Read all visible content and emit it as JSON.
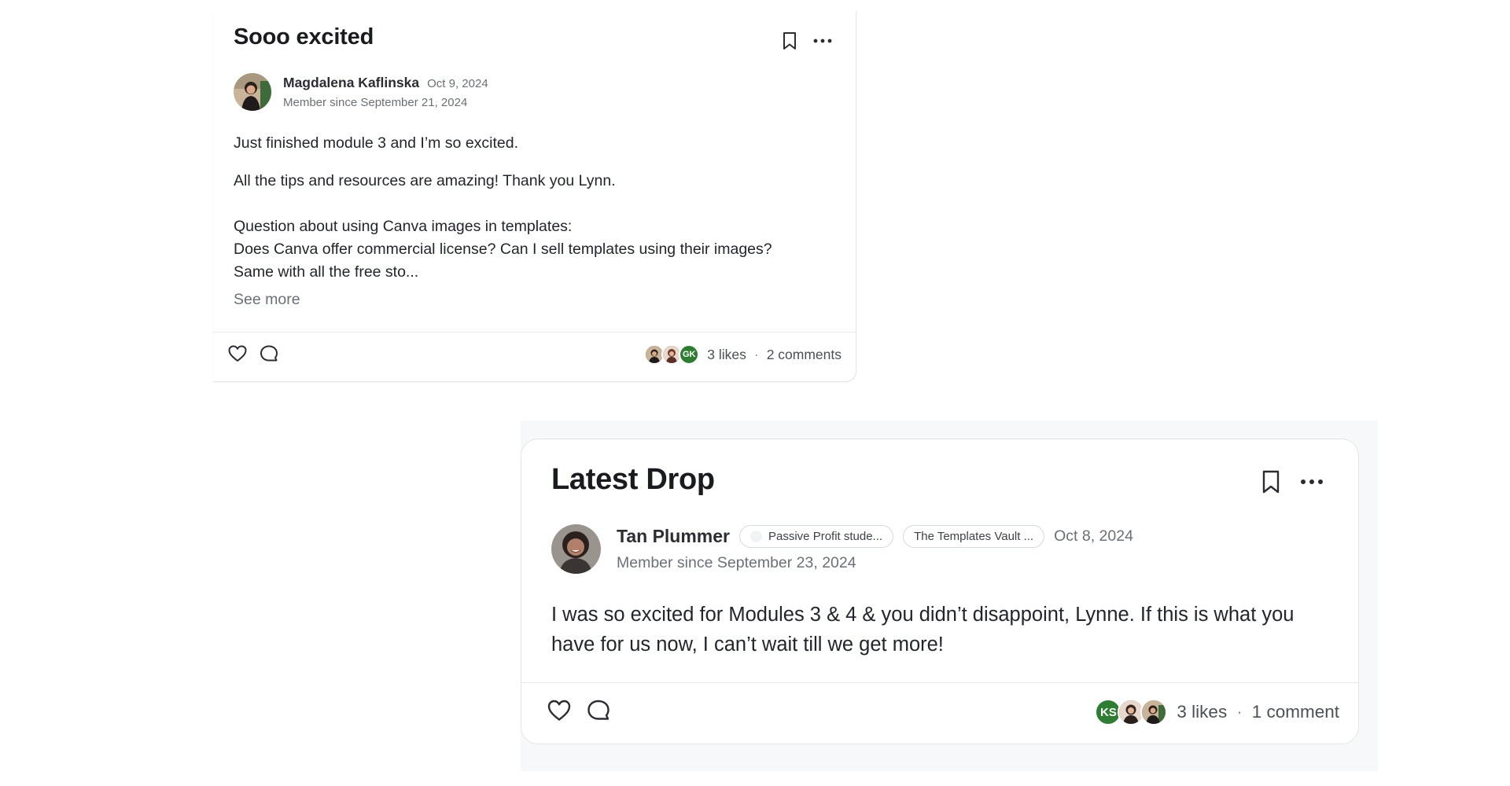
{
  "posts": [
    {
      "title": "Sooo excited",
      "author": "Magdalena Kaflinska",
      "date": "Oct 9, 2024",
      "member_since": "Member since September 21, 2024",
      "body": [
        "Just finished module 3 and I’m so excited.",
        "All the tips and resources are amazing! Thank you Lynn.",
        "Question about using Canva images in templates:",
        "Does Canva offer commercial license? Can I sell templates using their images?",
        "Same with all the free sto..."
      ],
      "see_more": "See more",
      "likers": [
        {
          "initials": "",
          "color": "#3a2e2a"
        },
        {
          "initials": "",
          "color": "#8a5a4a"
        },
        {
          "initials": "GK",
          "color": "#2e7d32"
        }
      ],
      "likes": "3 likes",
      "separator": "·",
      "comments": "2 comments"
    },
    {
      "title": "Latest Drop",
      "author": "Tan Plummer",
      "badges": [
        "Passive Profit stude...",
        "The Templates Vault ..."
      ],
      "date": "Oct 8, 2024",
      "member_since": "Member since September 23, 2024",
      "body": "I was so excited for Modules 3 & 4 & you didn’t disappoint, Lynne. If this is what you have for us now, I can’t wait till we get more!",
      "likers": [
        {
          "initials": "KS",
          "color": "#2e7d32"
        },
        {
          "initials": "",
          "color": "#5a3d33"
        },
        {
          "initials": "",
          "color": "#7a6a60"
        }
      ],
      "likes": "3 likes",
      "separator": "·",
      "comments": "1 comment"
    }
  ],
  "icons": [
    "bookmark-icon",
    "more-icon",
    "heart-icon",
    "comment-icon"
  ]
}
